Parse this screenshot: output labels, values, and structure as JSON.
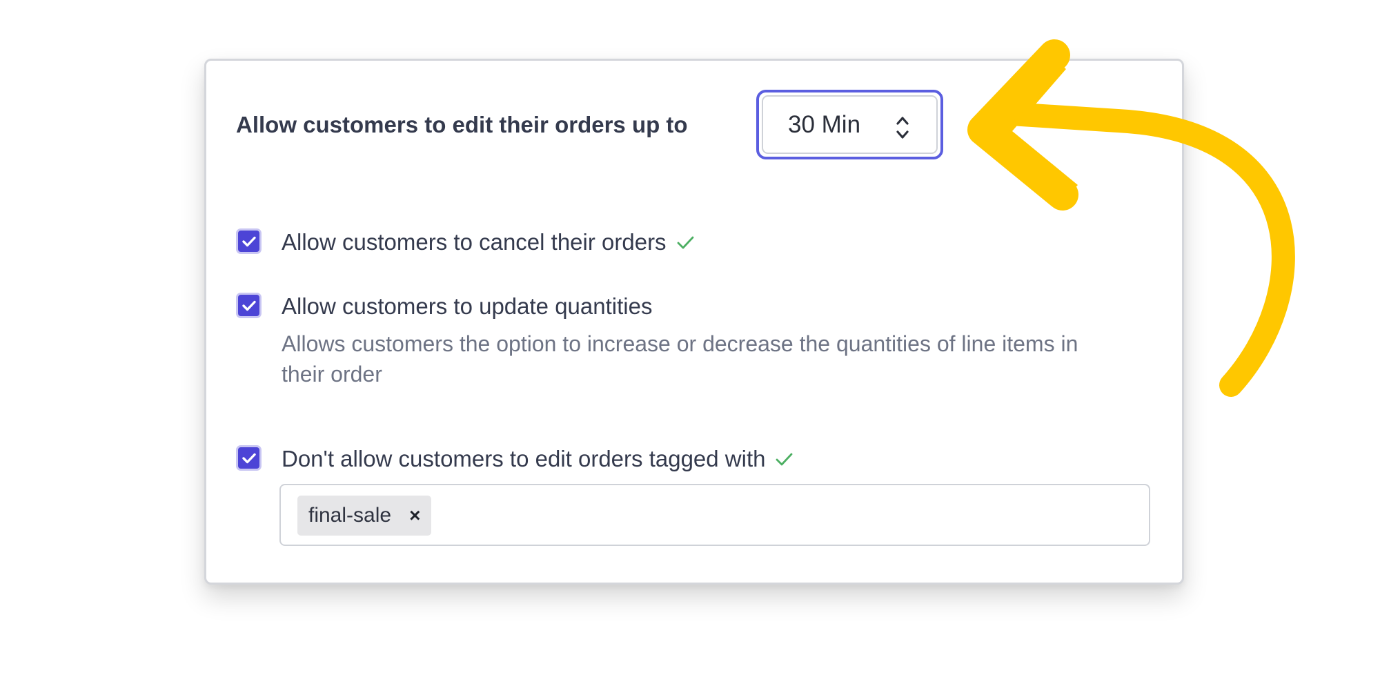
{
  "settings": {
    "edit_window_label": "Allow customers to edit their orders up to",
    "edit_window_value": "30 Min",
    "options": [
      {
        "label": "Allow customers to cancel their orders",
        "checked": true,
        "saved": true
      },
      {
        "label": "Allow customers to update quantities",
        "checked": true,
        "description": "Allows customers the option to increase or decrease the quantities of line items in their order"
      },
      {
        "label": "Don't allow customers to edit orders tagged with",
        "checked": true,
        "saved": true
      }
    ],
    "tags": [
      "final-sale"
    ],
    "tag_remove_icon": "×"
  },
  "icons": {
    "select": "chevron-up-down-icon",
    "checkbox": "checkmark-icon",
    "saved": "check-icon",
    "annotation": "curved-arrow-icon"
  },
  "colors": {
    "accent": "#4c44d6",
    "focus_ring": "#5b5ee0",
    "saved_check": "#4caf62",
    "annotation_arrow": "#ffc700"
  }
}
